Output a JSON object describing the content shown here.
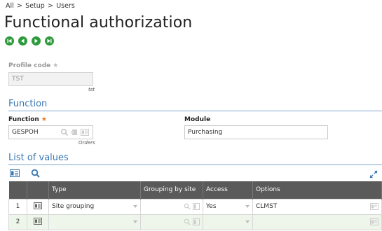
{
  "breadcrumb": {
    "items": [
      "All",
      "Setup",
      "Users"
    ],
    "separator": ">"
  },
  "page": {
    "title": "Functional authorization"
  },
  "nav": {
    "buttons": [
      "first",
      "previous",
      "next",
      "last"
    ]
  },
  "profile": {
    "label": "Profile code",
    "value": "TST",
    "sublabel": "tst"
  },
  "function_section": {
    "title": "Function"
  },
  "function_field": {
    "label": "Function",
    "value": "GESPOH",
    "sublabel": "Orders"
  },
  "module_field": {
    "label": "Module",
    "value": "Purchasing"
  },
  "list_section": {
    "title": "List of values"
  },
  "grid": {
    "columns": [
      "Type",
      "Grouping by site",
      "Access",
      "Options"
    ],
    "rows": [
      {
        "num": "1",
        "type": "Site grouping",
        "grouping": "",
        "access": "Yes",
        "options": "CLMST"
      },
      {
        "num": "2",
        "type": "",
        "grouping": "",
        "access": "",
        "options": ""
      }
    ]
  },
  "colors": {
    "accent": "#3a78b4",
    "nav_green": "#2e9a3c",
    "header_bg": "#5a5a5a",
    "required": "#e87a2b"
  }
}
